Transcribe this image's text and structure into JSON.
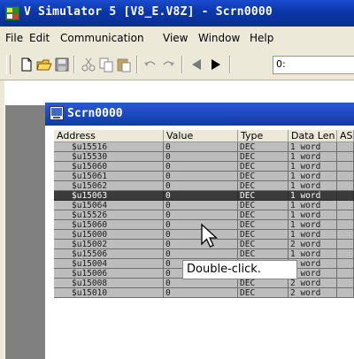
{
  "window": {
    "title": "V Simulator 5 [V8_E.V8Z] - Scrn0000",
    "app_icon": "simulator-app-icon"
  },
  "menu": [
    {
      "label": "File"
    },
    {
      "label": "Edit"
    },
    {
      "label": "Communication"
    },
    {
      "label": "View"
    },
    {
      "label": "Window"
    },
    {
      "label": "Help"
    }
  ],
  "toolbar": {
    "buttons": [
      "new-icon",
      "open-icon",
      "save-icon",
      "cut-icon",
      "copy-icon",
      "paste-icon",
      "undo-icon",
      "redo-icon",
      "back-arrow-icon",
      "forward-arrow-icon"
    ],
    "combo_value": "0:"
  },
  "child_window": {
    "title": "Scrn0000",
    "columns": [
      "Address",
      "Value",
      "Type",
      "Data Len",
      "AS"
    ],
    "rows": [
      {
        "address": "$u15516",
        "value": "0",
        "type": "DEC",
        "len": "1 word"
      },
      {
        "address": "$u15530",
        "value": "0",
        "type": "DEC",
        "len": "1 word"
      },
      {
        "address": "$u15060",
        "value": "0",
        "type": "DEC",
        "len": "1 word"
      },
      {
        "address": "$u15061",
        "value": "0",
        "type": "DEC",
        "len": "1 word"
      },
      {
        "address": "$u15062",
        "value": "0",
        "type": "DEC",
        "len": "1 word"
      },
      {
        "address": "$u15063",
        "value": "0",
        "type": "DEC",
        "len": "1 word",
        "selected": true
      },
      {
        "address": "$u15064",
        "value": "0",
        "type": "DEC",
        "len": "1 word"
      },
      {
        "address": "$u15526",
        "value": "0",
        "type": "DEC",
        "len": "1 word"
      },
      {
        "address": "$u15060",
        "value": "0",
        "type": "DEC",
        "len": "1 word"
      },
      {
        "address": "$u15000",
        "value": "0",
        "type": "DEC",
        "len": "1 word"
      },
      {
        "address": "$u15002",
        "value": "0",
        "type": "DEC",
        "len": "2 word"
      },
      {
        "address": "$u15506",
        "value": "0",
        "type": "DEC",
        "len": "1 word"
      },
      {
        "address": "$u15004",
        "value": "0",
        "type": "DEC",
        "len": "2 word"
      },
      {
        "address": "$u15006",
        "value": "0",
        "type": "DEC",
        "len": "2 word"
      },
      {
        "address": "$u15008",
        "value": "0",
        "type": "DEC",
        "len": "2 word"
      },
      {
        "address": "$u15010",
        "value": "0",
        "type": "DEC",
        "len": "2 word"
      }
    ]
  },
  "tooltip": "Double-click."
}
